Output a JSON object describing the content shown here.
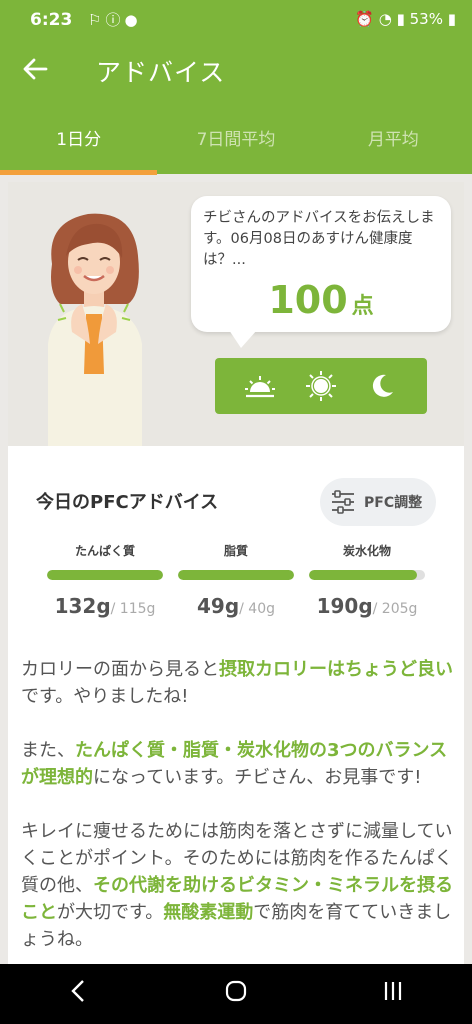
{
  "status_bar": {
    "time": "6:23",
    "battery": "53%"
  },
  "app_bar": {
    "title": "アドバイス"
  },
  "tabs": [
    {
      "label": "1日分",
      "active": true
    },
    {
      "label": "7日間平均",
      "active": false
    },
    {
      "label": "月平均",
      "active": false
    }
  ],
  "bubble": {
    "message": "チビさんのアドバイスをお伝えします。06月08日のあすけん健康度は？...",
    "score": "100",
    "score_unit": "点"
  },
  "time_of_day": [
    "sunrise-icon",
    "sun-icon",
    "moon-icon"
  ],
  "pfc": {
    "heading": "今日のPFCアドバイス",
    "adjust_button": "PFC調整",
    "items": [
      {
        "name": "たんぱく質",
        "value": "132",
        "unit": "g",
        "target": "/ 115g",
        "fill": 1.0
      },
      {
        "name": "脂質",
        "value": "49",
        "unit": "g",
        "target": "/ 40g",
        "fill": 1.0
      },
      {
        "name": "炭水化物",
        "value": "190",
        "unit": "g",
        "target": "/ 205g",
        "fill": 0.93
      }
    ]
  },
  "advice": {
    "p1_a": "カロリーの面から見ると",
    "p1_b": "摂取カロリーはちょうど良い",
    "p1_c": "です。やりましたね!",
    "p2_a": "また、",
    "p2_b": "たんぱく質・脂質・炭水化物の3つのバランスが理想的",
    "p2_c": "になっています。チビさん、お見事です!",
    "p3_a": "キレイに痩せるためには筋肉を落とさずに減量していくことがポイント。そのためには筋肉を作るたんぱく質の他、",
    "p3_b": "その代謝を助けるビタミン・ミネラルを摂ること",
    "p3_c": "が大切です。",
    "p3_d": "無酸素運動",
    "p3_e": "で筋肉を育てていきましょうね。"
  },
  "colors": {
    "primary": "#7db53a",
    "tab_indicator": "#f3a03c"
  }
}
